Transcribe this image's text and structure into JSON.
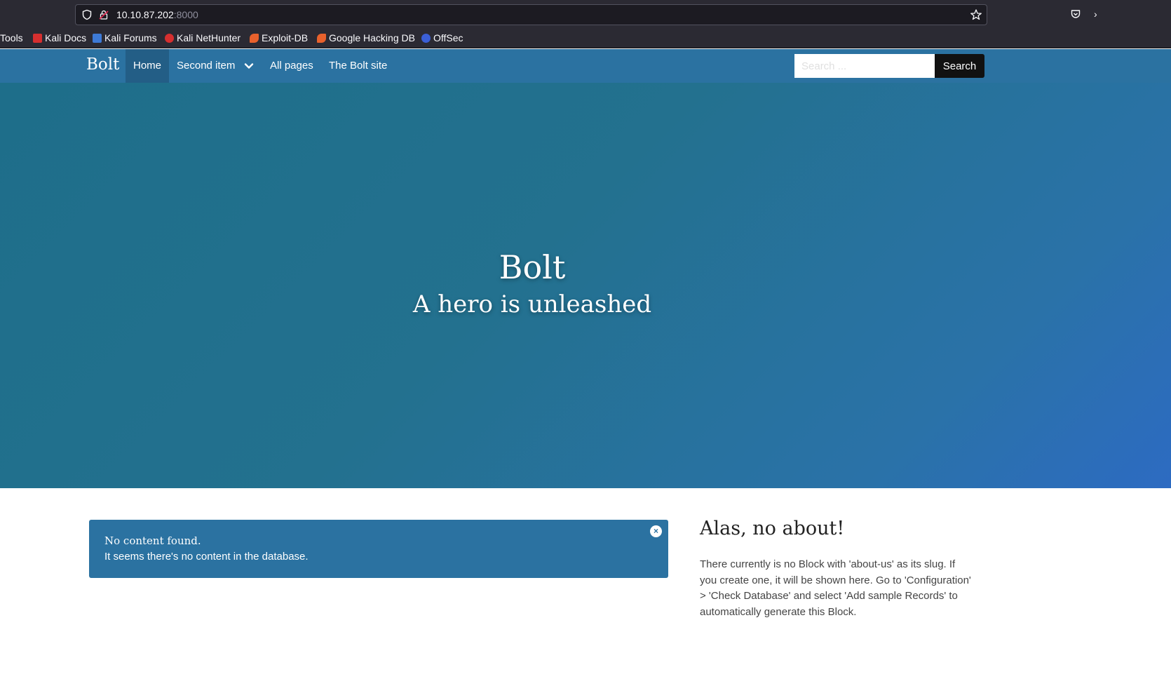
{
  "browser": {
    "url_host": "10.10.87.202",
    "url_port": ":8000",
    "bookmarks": [
      {
        "label": "Tools",
        "icon": "none"
      },
      {
        "label": "Kali Docs",
        "icon": "kali-docs-icon",
        "color": "#d62f2f"
      },
      {
        "label": "Kali Forums",
        "icon": "kali-forums-icon",
        "color": "#3d7ad6"
      },
      {
        "label": "Kali NetHunter",
        "icon": "kali-nethunter-icon",
        "color": "#d62f2f"
      },
      {
        "label": "Exploit-DB",
        "icon": "exploit-db-icon",
        "color": "#e8612c"
      },
      {
        "label": "Google Hacking DB",
        "icon": "ghdb-icon",
        "color": "#e8612c"
      },
      {
        "label": "OffSec",
        "icon": "offsec-icon",
        "color": "#3b5fd6"
      }
    ]
  },
  "nav": {
    "brand": "Bolt",
    "items": [
      {
        "label": "Home",
        "active": true
      },
      {
        "label": "Second item",
        "dropdown": true
      },
      {
        "label": "All pages"
      },
      {
        "label": "The Bolt site"
      }
    ],
    "search_placeholder": "Search ...",
    "search_button": "Search"
  },
  "hero": {
    "title": "Bolt",
    "subtitle": "A hero is unleashed"
  },
  "alert": {
    "title": "No content found.",
    "body": "It seems there's no content in the database.",
    "close": "×"
  },
  "about": {
    "title": "Alas, no about!",
    "text": "There currently is no Block with 'about-us' as its slug. If you create one, it will be shown here. Go to 'Configuration' > 'Check Database' and select 'Add sample Records' to automatically generate this Block."
  },
  "colors": {
    "nav_bg": "#2b72a1",
    "hero_start": "#1e6e8a",
    "hero_end": "#2d6bc2",
    "alert_bg": "#2b72a1"
  }
}
